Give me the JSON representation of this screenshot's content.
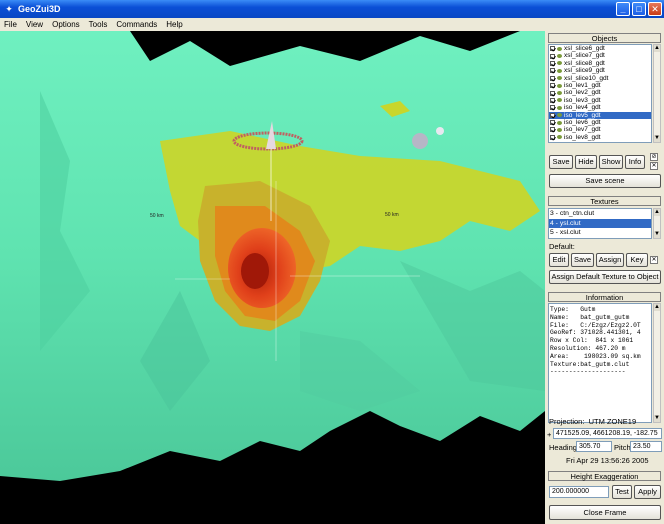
{
  "window": {
    "title": "GeoZui3D",
    "icon": "app-icon"
  },
  "menu": [
    "File",
    "View",
    "Options",
    "Tools",
    "Commands",
    "Help"
  ],
  "viewport": {
    "labels": [
      "50 km",
      "50 km"
    ]
  },
  "objects": {
    "title": "Objects",
    "items": [
      {
        "label": "xsl_slice6_gdt",
        "checked": true
      },
      {
        "label": "xsl_slice7_gdt",
        "checked": true
      },
      {
        "label": "xsl_slice8_gdt",
        "checked": true
      },
      {
        "label": "xsl_slice9_gdt",
        "checked": true
      },
      {
        "label": "xsl_slice10_gdt",
        "checked": true
      },
      {
        "label": "iso_lev1_gdt",
        "checked": true
      },
      {
        "label": "iso_lev2_gdt",
        "checked": true
      },
      {
        "label": "iso_lev3_gdt",
        "checked": true
      },
      {
        "label": "iso_lev4_gdt",
        "checked": true
      },
      {
        "label": "iso_lev5_gdt",
        "checked": true,
        "selected": true
      },
      {
        "label": "iso_lev6_gdt",
        "checked": true
      },
      {
        "label": "iso_lev7_gdt",
        "checked": true
      },
      {
        "label": "iso_lev8_gdt",
        "checked": true
      }
    ],
    "buttons": [
      "Save",
      "Hide",
      "Show",
      "Info"
    ],
    "save_scene": "Save scene"
  },
  "textures": {
    "title": "Textures",
    "items": [
      {
        "label": "3 - ctn_ctn.clut"
      },
      {
        "label": "4 - ysl.clut",
        "selected": true
      },
      {
        "label": "5 - xsl.clut"
      }
    ],
    "default_label": "Default:",
    "buttons": [
      "Edit",
      "Save",
      "Assign",
      "Key"
    ],
    "assign_default": "Assign Default Texture to Object"
  },
  "information": {
    "title": "Information",
    "lines": [
      "Type:   Gutm",
      "Name:   bat_gutm_gutm",
      "File:   C:/Ezgz/Ezgz2.0T",
      "GeoRef: 371028.441301, 4",
      "Row x Col:  841 x 1061",
      "Resolution: 467.20 m",
      "Area:    198023.09 sq.km",
      "Texture:bat_gutm.clut",
      "--------------------"
    ],
    "projection_label": "Projection:",
    "projection_value": "UTM ZONE19",
    "coords": "471525.09, 4661208.19, -182.75",
    "heading_label": "Heading",
    "heading_value": "305.70",
    "pitch_label": "Pitch",
    "pitch_value": "23.50",
    "datetime": "Fri Apr 29 13:56:26 2005"
  },
  "height": {
    "title": "Height Exaggeration",
    "value": "200.000000",
    "test": "Test",
    "apply": "Apply"
  },
  "close_frame": "Close Frame",
  "colors": {
    "seafloor": "#5fe3b0",
    "iso_yellow": "#c8d62c",
    "iso_orange": "#e08a1c",
    "iso_red": "#d83010",
    "titlebar": "#0a4fd6",
    "selection": "#316ac5"
  }
}
